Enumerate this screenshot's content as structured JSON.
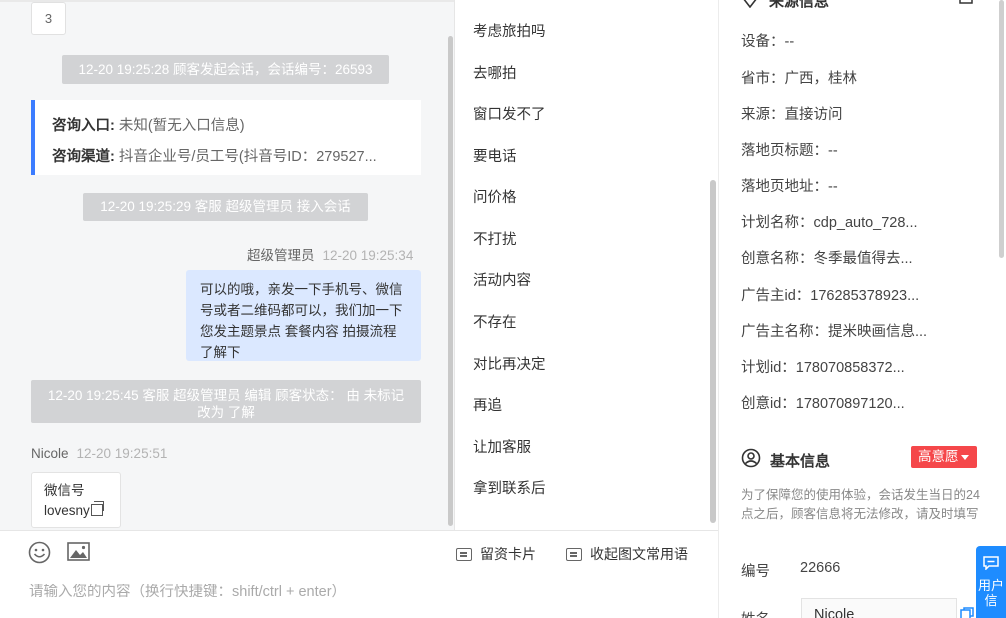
{
  "chat": {
    "page_number": "3",
    "system_msgs": [
      "12-20 19:25:28 顾客发起会话，会话编号：26593",
      "12-20 19:25:29 客服 超级管理员 接入会话",
      "12-20 19:25:45 客服 超级管理员 编辑 顾客状态： 由 未标记 改为 了解"
    ],
    "entry": {
      "entry_label": "咨询入口:",
      "entry_value": "未知(暂无入口信息)",
      "channel_label": "咨询渠道:",
      "channel_value": "抖音企业号/员工号(抖音号ID：279527..."
    },
    "agent_msg": {
      "sender": "超级管理员",
      "time": "12-20 19:25:34",
      "text": "可以的哦，亲发一下手机号、微信号或者二维码都可以，我们加一下您发主题景点 套餐内容 拍摄流程了解下"
    },
    "customer_msg": {
      "sender": "Nicole",
      "time": "12-20 19:25:51",
      "line1": "微信号",
      "line2": "lovesny"
    }
  },
  "quick_replies": [
    "考虑旅拍吗",
    "去哪拍",
    "窗口发不了",
    "要电话",
    "问价格",
    "不打扰",
    "活动内容",
    "不存在",
    "对比再决定",
    "再追",
    "让加客服",
    "拿到联系后"
  ],
  "toolbar": {
    "emoji_icon": "smile-icon",
    "image_icon": "image-icon",
    "lead_card_label": "留资卡片",
    "collapse_label": "收起图文常用语",
    "input_placeholder": "请输入您的内容（换行快捷键：shift/ctrl + enter）"
  },
  "info_panel": {
    "source_title": "来源信息",
    "rows": [
      {
        "label": "设备：",
        "value": "--"
      },
      {
        "label": "省市：",
        "value": "广西，桂林"
      },
      {
        "label": "来源：",
        "value": "直接访问"
      },
      {
        "label": "落地页标题：",
        "value": "--"
      },
      {
        "label": "落地页地址：",
        "value": "--"
      },
      {
        "label": "计划名称：",
        "value": "cdp_auto_728..."
      },
      {
        "label": "创意名称：",
        "value": "冬季最值得去..."
      },
      {
        "label": "广告主id：",
        "value": "176285378923..."
      },
      {
        "label": "广告主名称：",
        "value": "提米映画信息..."
      },
      {
        "label": "计划id：",
        "value": "178070858372..."
      },
      {
        "label": "创意id：",
        "value": "178070897120..."
      }
    ],
    "basic_title": "基本信息",
    "intent_badge": "高意愿",
    "note": "为了保障您的使用体验，会话发生当日的24点之后，顾客信息将无法修改，请及时填写",
    "id_label": "编号",
    "id_value": "22666",
    "name_label": "姓名",
    "name_value": "Nicole",
    "float_button": "用户信"
  },
  "colors": {
    "accent": "#3b7cff",
    "badge": "#f5474a",
    "float_button": "#1e8cff",
    "agent_bubble": "#dbe8ff"
  }
}
